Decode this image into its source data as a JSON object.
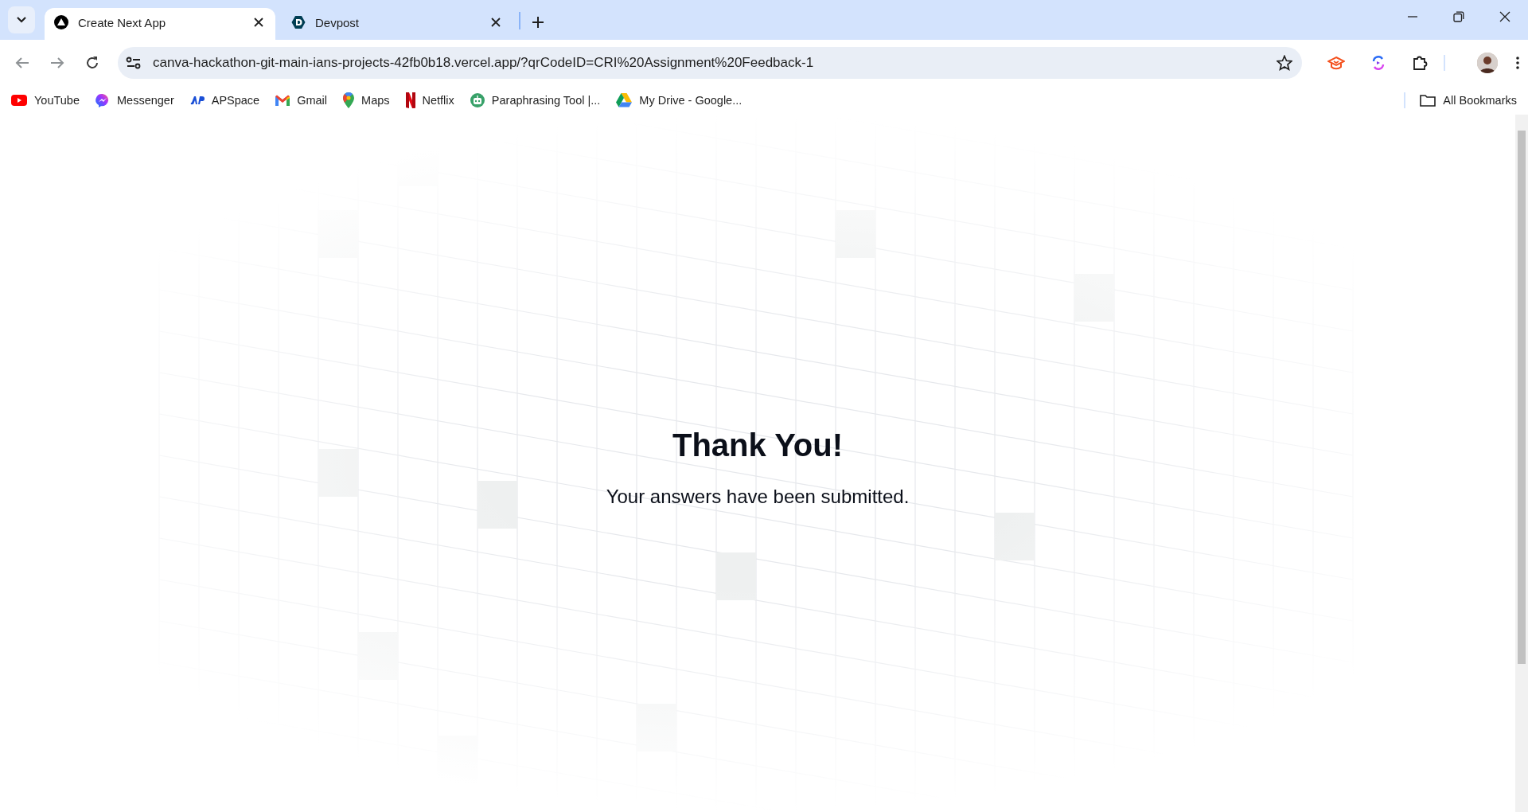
{
  "tabs": [
    {
      "title": "Create Next App",
      "selected": true
    },
    {
      "title": "Devpost",
      "selected": false
    }
  ],
  "address_bar": {
    "url": "canva-hackathon-git-main-ians-projects-42fb0b18.vercel.app/?qrCodeID=CRI%20Assignment%20Feedback-1"
  },
  "bookmarks": [
    {
      "label": "YouTube"
    },
    {
      "label": "Messenger"
    },
    {
      "label": "APSpace"
    },
    {
      "label": "Gmail"
    },
    {
      "label": "Maps"
    },
    {
      "label": "Netflix"
    },
    {
      "label": "Paraphrasing Tool |..."
    },
    {
      "label": "My Drive - Google..."
    }
  ],
  "all_bookmarks": "All Bookmarks",
  "page": {
    "heading": "Thank You!",
    "message": "Your answers have been submitted."
  }
}
